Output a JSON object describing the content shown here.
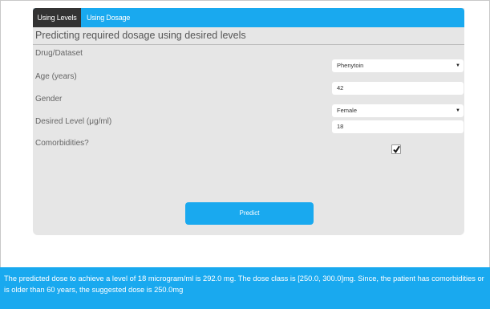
{
  "tabs": {
    "using_levels": "Using Levels",
    "using_dosage": "Using Dosage"
  },
  "form": {
    "title": "Predicting required dosage using desired levels",
    "drug_label": "Drug/Dataset",
    "drug_value": "Phenytoin",
    "age_label": "Age (years)",
    "age_value": "42",
    "gender_label": "Gender",
    "gender_value": "Female",
    "level_label": "Desired Level (μg/ml)",
    "level_value": "18",
    "comorbidities_label": "Comorbidities?",
    "comorbidities_checked": true,
    "predict_label": "Predict"
  },
  "result": {
    "text": "The predicted dose to achieve a level of 18 microgram/ml is 292.0 mg. The dose class is [250.0, 300.0]mg. Since, the patient has comorbidities or is older than 60 years, the suggested dose is 250.0mg"
  },
  "colors": {
    "accent": "#19a9ef",
    "active_tab": "#333333",
    "panel": "#e6e6e6"
  },
  "icons": {
    "select_arrow": "caret-down-icon",
    "checkmark": "checkmark-icon"
  }
}
